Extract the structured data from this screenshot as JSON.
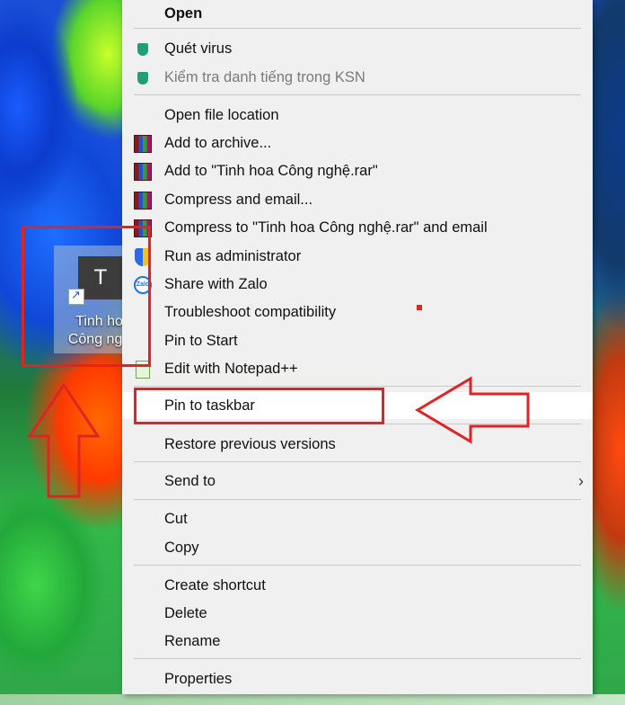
{
  "desktop": {
    "icon": {
      "tile_letter": "T",
      "label_line1": "Tinh hoa",
      "label_line2": "Công nghệ"
    }
  },
  "context_menu": {
    "items": [
      {
        "label": "Open",
        "bold": true
      },
      {
        "label": "Quét virus",
        "icon": "kaspersky-shield-icon"
      },
      {
        "label": "Kiểm tra danh tiếng trong KSN",
        "icon": "kaspersky-shield-icon",
        "disabled": true
      },
      {
        "label": "Open file location"
      },
      {
        "label": "Add to archive...",
        "icon": "winrar-icon"
      },
      {
        "label": "Add to \"Tinh hoa Công nghệ.rar\"",
        "icon": "winrar-icon"
      },
      {
        "label": "Compress and email...",
        "icon": "winrar-icon"
      },
      {
        "label": "Compress to \"Tinh hoa Công nghệ.rar\" and email",
        "icon": "winrar-icon"
      },
      {
        "label": "Run as administrator",
        "icon": "uac-shield-icon"
      },
      {
        "label": "Share with Zalo",
        "icon": "zalo-icon"
      },
      {
        "label": "Troubleshoot compatibility"
      },
      {
        "label": "Pin to Start"
      },
      {
        "label": "Edit with Notepad++",
        "icon": "notepadpp-icon"
      },
      {
        "label": "Pin to taskbar",
        "highlighted": true
      },
      {
        "label": "Restore previous versions"
      },
      {
        "label": "Send to",
        "submenu": true
      },
      {
        "label": "Cut"
      },
      {
        "label": "Copy"
      },
      {
        "label": "Create shortcut"
      },
      {
        "label": "Delete"
      },
      {
        "label": "Rename"
      },
      {
        "label": "Properties"
      }
    ],
    "submenu_glyph": "›",
    "zalo_text": "Zalo"
  },
  "colors": {
    "menu_bg": "#f0f0f0",
    "highlight_bg": "#ffffff",
    "annotation_red": "#e02424",
    "disabled_text": "#7a7a7a"
  }
}
